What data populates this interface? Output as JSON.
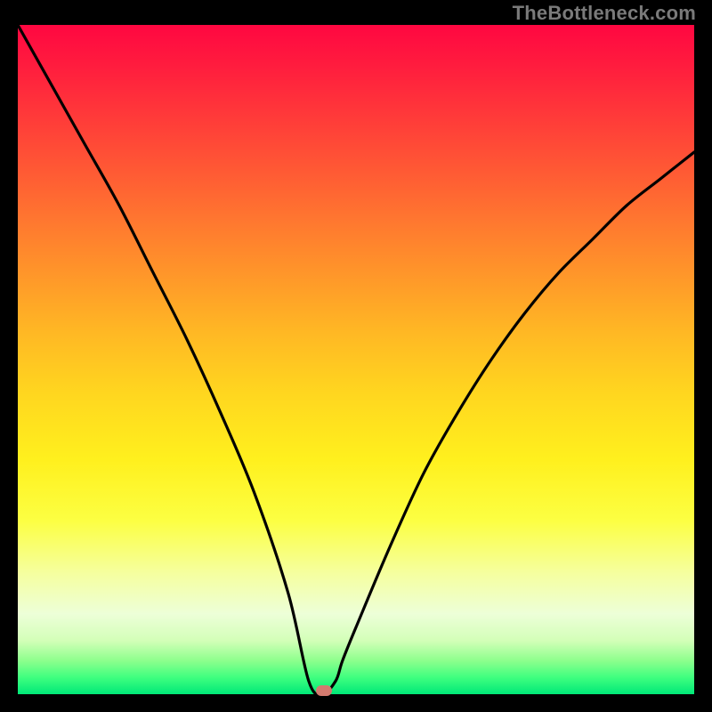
{
  "watermark": "TheBottleneck.com",
  "chart_data": {
    "type": "line",
    "title": "",
    "xlabel": "",
    "ylabel": "",
    "xlim": [
      0,
      100
    ],
    "ylim": [
      0,
      100
    ],
    "grid": false,
    "series": [
      {
        "name": "bottleneck-curve",
        "x": [
          0,
          5,
          10,
          15,
          20,
          25,
          30,
          35,
          40,
          43,
          45,
          47,
          48,
          50,
          55,
          60,
          65,
          70,
          75,
          80,
          85,
          90,
          95,
          100
        ],
        "y": [
          100,
          91,
          82,
          73,
          63,
          53,
          42,
          30,
          15,
          2,
          0,
          2,
          5,
          10,
          22,
          33,
          42,
          50,
          57,
          63,
          68,
          73,
          77,
          81
        ]
      }
    ],
    "marker": {
      "name": "optimal-point",
      "x": 45.3,
      "y": 0.5,
      "color": "#d47a6f"
    },
    "background_gradient": {
      "orientation": "vertical",
      "stops": [
        {
          "pos": 0.0,
          "color": "#ff0741"
        },
        {
          "pos": 0.5,
          "color": "#ffcf22"
        },
        {
          "pos": 0.82,
          "color": "#f5ffa0"
        },
        {
          "pos": 1.0,
          "color": "#00e878"
        }
      ]
    }
  }
}
